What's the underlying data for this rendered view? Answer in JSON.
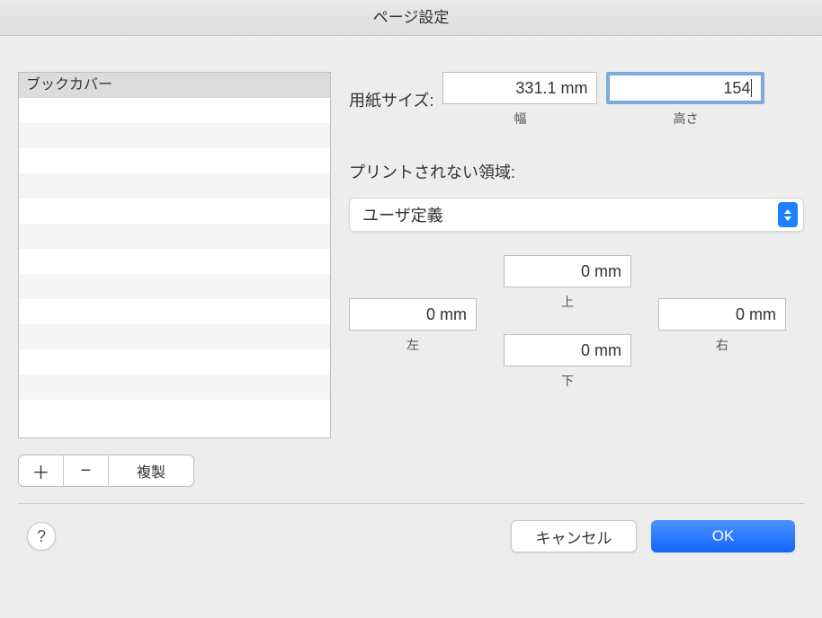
{
  "window": {
    "title": "ページ設定"
  },
  "presets": {
    "items": [
      "ブックカバー"
    ]
  },
  "toolbar": {
    "duplicate_label": "複製"
  },
  "paper_size": {
    "label": "用紙サイズ:",
    "width_value": "331.1 mm",
    "width_label": "幅",
    "height_value": "154",
    "height_label": "高さ"
  },
  "non_print_area": {
    "label": "プリントされない領域:",
    "preset_selected": "ユーザ定義"
  },
  "margins": {
    "top_value": "0 mm",
    "top_label": "上",
    "left_value": "0 mm",
    "left_label": "左",
    "right_value": "0 mm",
    "right_label": "右",
    "bottom_value": "0 mm",
    "bottom_label": "下"
  },
  "footer": {
    "cancel_label": "キャンセル",
    "ok_label": "OK"
  }
}
